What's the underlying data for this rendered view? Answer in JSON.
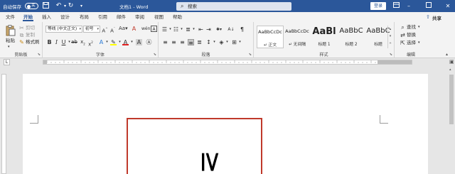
{
  "titlebar": {
    "autosave_label": "自动保存",
    "toggle_text": "关",
    "doc_title": "文档1 - Word",
    "search_placeholder": "搜索",
    "login_label": "登录"
  },
  "menu": {
    "items": [
      "文件",
      "开始",
      "插入",
      "设计",
      "布局",
      "引用",
      "邮件",
      "审阅",
      "视图",
      "帮助"
    ],
    "active": "开始",
    "share_label": "共享"
  },
  "ribbon": {
    "clipboard": {
      "paste_label": "粘贴",
      "cut_label": "剪切",
      "copy_label": "复制",
      "format_painter_label": "格式刷",
      "group_label": "剪贴板"
    },
    "font": {
      "font_name": "等线 (中文正文)",
      "font_size": "初号",
      "group_label": "字体"
    },
    "paragraph": {
      "group_label": "段落"
    },
    "styles": {
      "tiles": [
        {
          "preview": "AaBbCcDc",
          "name": "↵ 正文",
          "selected": true
        },
        {
          "preview": "AaBbCcDc",
          "name": "↵ 无间隔",
          "selected": false
        },
        {
          "preview": "AaBl",
          "name": "标题 1",
          "selected": false
        },
        {
          "preview": "AaBbC",
          "name": "标题 2",
          "selected": false
        },
        {
          "preview": "AaBbC",
          "name": "标题",
          "selected": false
        }
      ],
      "group_label": "样式"
    },
    "editing": {
      "find_label": "查找",
      "replace_label": "替换",
      "select_label": "选择",
      "group_label": "编辑"
    }
  },
  "document": {
    "shape_text": "≥",
    "shape_border_color": "#c0392b"
  },
  "colors": {
    "title_bar": "#2b579a",
    "font_color": "#e02020",
    "highlight": "#ffff00"
  }
}
